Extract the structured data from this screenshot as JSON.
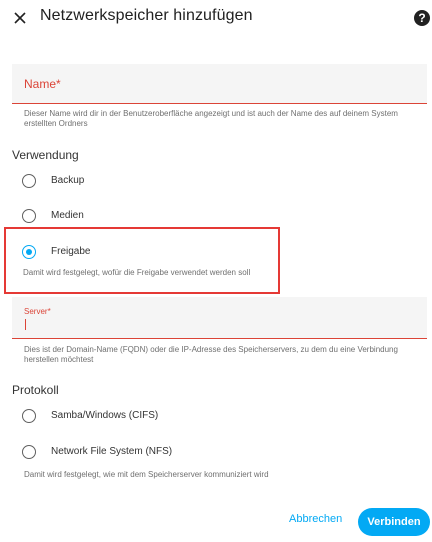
{
  "header": {
    "title": "Netzwerkspeicher hinzufügen",
    "help_glyph": "?"
  },
  "name_field": {
    "label": "Name*",
    "helper": "Dieser Name wird dir in der Benutzeroberfläche angezeigt und ist auch der Name des auf deinem System erstellten Ordners"
  },
  "usage": {
    "title": "Verwendung",
    "options": [
      "Backup",
      "Medien",
      "Freigabe"
    ],
    "selected": "Freigabe",
    "helper": "Damit wird festgelegt, wofür die Freigabe verwendet werden soll"
  },
  "server_field": {
    "label": "Server*",
    "value": "",
    "helper": "Dies ist der Domain-Name (FQDN) oder die IP-Adresse des Speicherservers, zu dem du eine Verbindung herstellen möchtest"
  },
  "protocol": {
    "title": "Protokoll",
    "options": [
      "Samba/Windows (CIFS)",
      "Network File System (NFS)"
    ],
    "helper": "Damit wird festgelegt, wie mit dem Speicherserver kommuniziert wird"
  },
  "actions": {
    "cancel": "Abbrechen",
    "connect": "Verbinden"
  },
  "colors": {
    "accent": "#03a9f4",
    "error": "#db4437",
    "highlight": "#e53935"
  }
}
